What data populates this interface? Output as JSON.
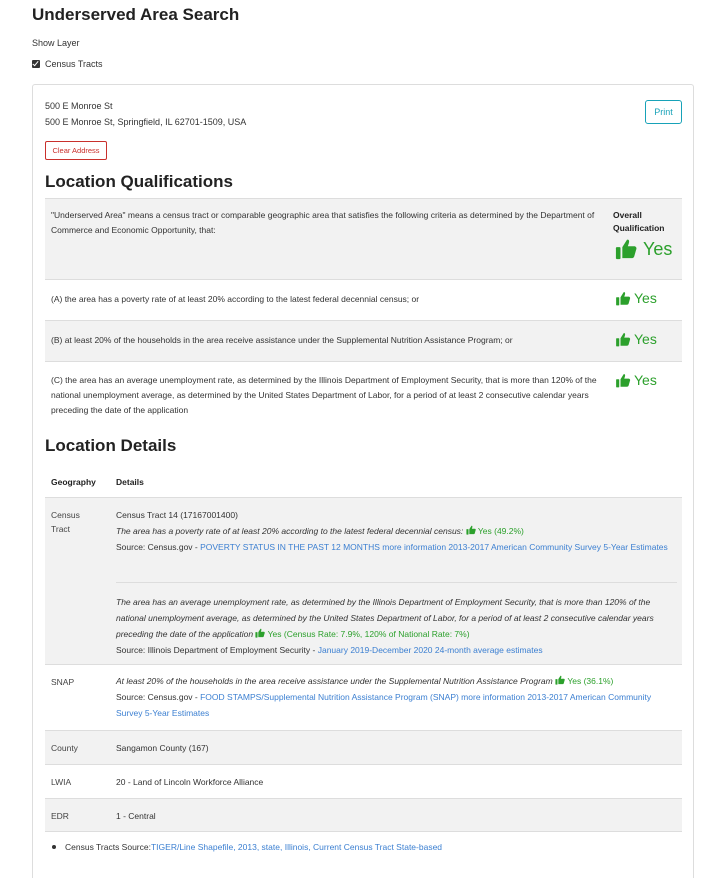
{
  "page": {
    "title": "Underserved Area Search",
    "show_layer": "Show Layer",
    "layer_label": "Census Tracts"
  },
  "address": {
    "line1": "500 E Monroe St",
    "line2": "500 E Monroe St, Springfield, IL 62701-1509, USA",
    "print_label": "Print",
    "clear_label": "Clear Address"
  },
  "qualifications": {
    "heading": "Location Qualifications",
    "intro": "\"Underserved Area\" means a census tract or comparable geographic area that satisfies the following criteria as determined by the Department of Commerce and Economic Opportunity, that:",
    "overall_label": "Overall Qualification",
    "overall_value": "Yes",
    "criteria": [
      {
        "text": "(A) the area has a poverty rate of at least 20% according to the latest federal decennial census; or",
        "result": "Yes"
      },
      {
        "text": "(B) at least 20% of the households in the area receive assistance under the Supplemental Nutrition Assistance Program; or",
        "result": "Yes"
      },
      {
        "text": "(C) the area has an average unemployment rate, as determined by the Illinois Department of Employment Security, that is more than 120% of the national unemployment average, as determined by the United States Department of Labor, for a period of at least 2 consecutive calendar years preceding the date of the application",
        "result": "Yes"
      }
    ]
  },
  "details": {
    "heading": "Location Details",
    "col_geography": "Geography",
    "col_details": "Details",
    "census": {
      "geo": "Census Tract",
      "tract": "Census Tract 14 (17167001400)",
      "poverty_text": "The area has a poverty rate of at least 20% according to the latest federal decennial census:",
      "poverty_result": "Yes (49.2%)",
      "source_prefix": "Source: Census.gov - ",
      "poverty_link": "POVERTY STATUS IN THE PAST 12 MONTHS more information 2013-2017 American Community Survey 5-Year Estimates",
      "unemp_text": "The area has an average unemployment rate, as determined by the Illinois Department of Employment Security, that is more than 120% of the national unemployment average, as determined by the United States Department of Labor, for a period of at least 2 consecutive calendar years preceding the date of the application",
      "unemp_result": "Yes (Census Rate: 7.9%, 120% of National Rate: 7%)",
      "unemp_source_prefix": "Source: Illinois Department of Employment Security - ",
      "unemp_link": "January 2019-December 2020 24-month average estimates"
    },
    "snap": {
      "geo": "SNAP",
      "text": "At least 20% of the households in the area receive assistance under the Supplemental Nutrition Assistance Program",
      "result": "Yes (36.1%)",
      "source_prefix": "Source: Census.gov - ",
      "link": "FOOD STAMPS/Supplemental Nutrition Assistance Program (SNAP) more information 2013-2017 American Community Survey 5-Year Estimates"
    },
    "county": {
      "geo": "County",
      "value": "Sangamon County (167)"
    },
    "lwia": {
      "geo": "LWIA",
      "value": "20 - Land of Lincoln Workforce Alliance"
    },
    "edr": {
      "geo": "EDR",
      "value": "1 - Central"
    }
  },
  "footnote": {
    "prefix": "Census Tracts Source: ",
    "link": "TIGER/Line Shapefile, 2013, state, Illinois, Current Census Tract State-based"
  },
  "colors": {
    "accent_green": "#2ca02c",
    "link_blue": "#3b7fd1",
    "print_teal": "#17a2b8",
    "clear_red": "#c9302c"
  }
}
